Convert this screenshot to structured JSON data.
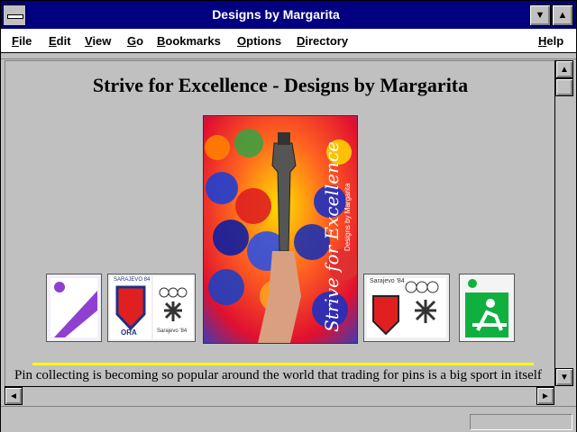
{
  "window": {
    "title": "Designs by Margarita"
  },
  "menu": {
    "items": [
      {
        "label": "File",
        "underline": "F",
        "rest": "ile"
      },
      {
        "label": "Edit",
        "underline": "E",
        "rest": "dit"
      },
      {
        "label": "View",
        "underline": "V",
        "rest": "iew"
      },
      {
        "label": "Go",
        "underline": "G",
        "rest": "o"
      },
      {
        "label": "Bookmarks",
        "underline": "B",
        "rest": "ookmarks"
      },
      {
        "label": "Options",
        "underline": "O",
        "rest": "ptions"
      },
      {
        "label": "Directory",
        "underline": "D",
        "rest": "irectory"
      }
    ],
    "help": {
      "label": "Help",
      "underline": "H",
      "rest": "elp"
    }
  },
  "page": {
    "heading": "Strive for Excellence - Designs by Margarita",
    "poster_text": "Strive for Excellence",
    "poster_subtext": "Designs by Margarita",
    "pin_texts": {
      "sarajevo1": "SARAJEVO 84",
      "ora": "ORA",
      "sarajevo2": "Sarajevo '84",
      "sarajevo3": "Sarajevo '84"
    },
    "body": "Pin collecting is becoming so popular around the world that trading for pins is a big sport in itself"
  },
  "colors": {
    "titlebar": "#000080",
    "chrome": "#c0c0c0",
    "accent_rule": "#ffff00"
  }
}
